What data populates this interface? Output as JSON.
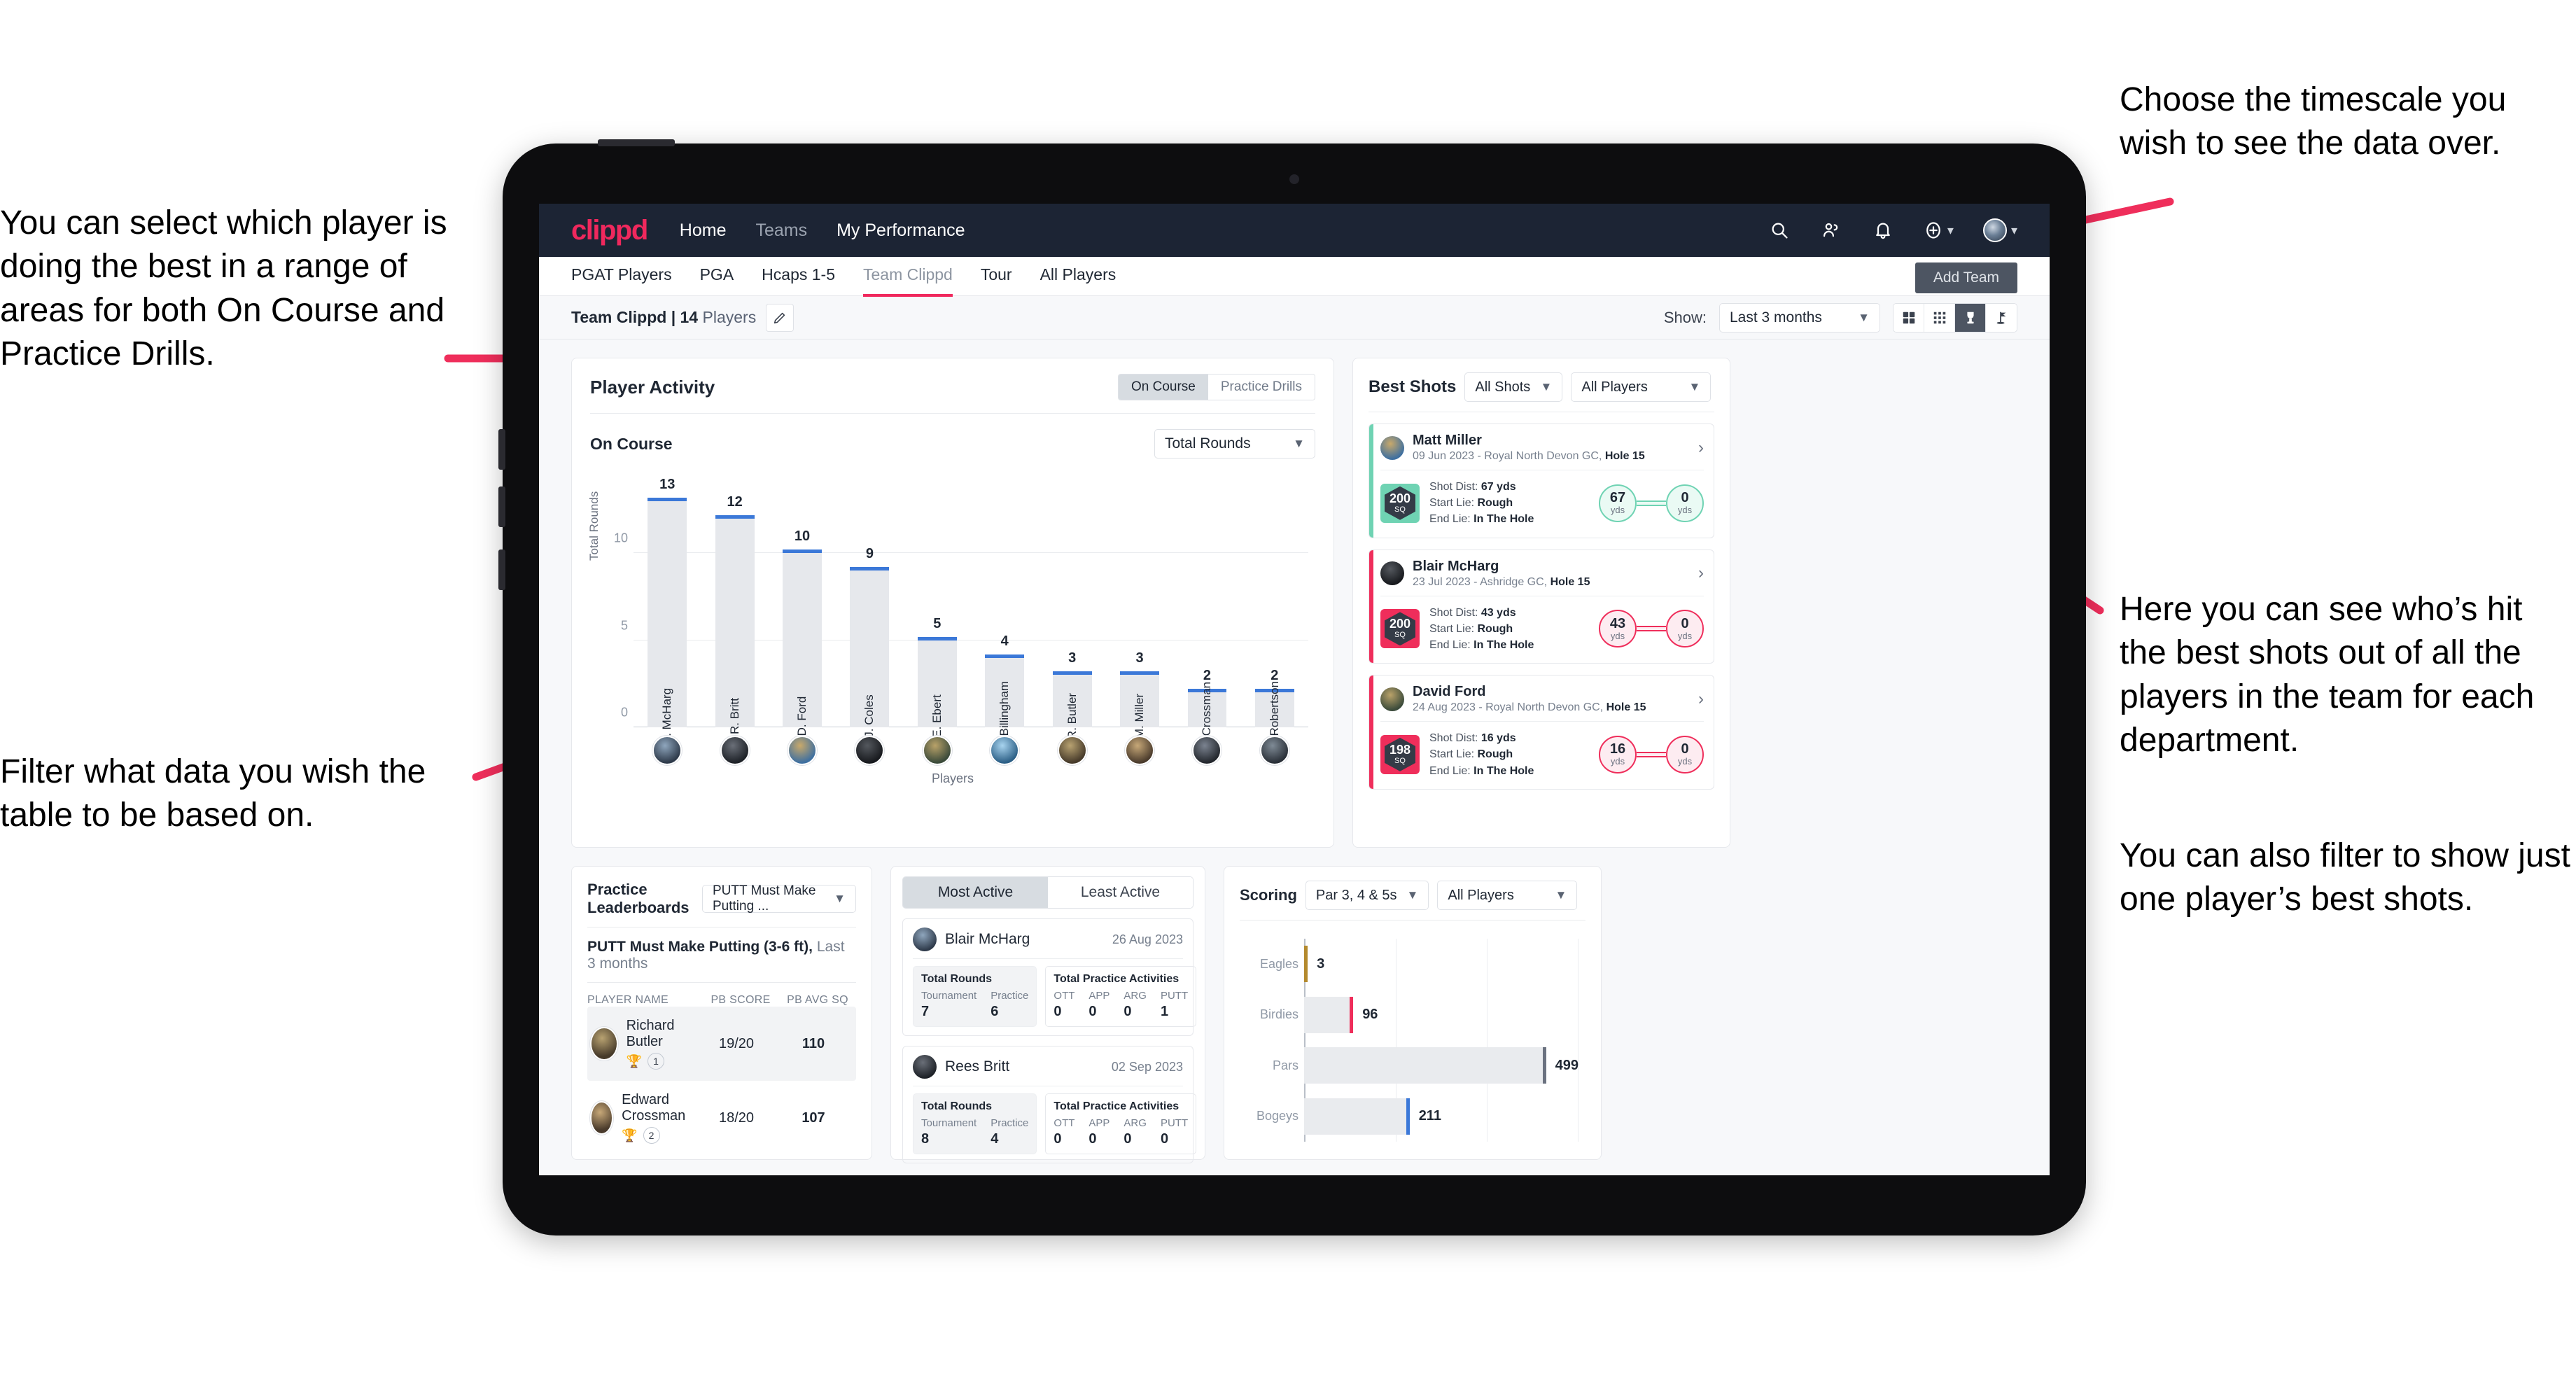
{
  "annotations": {
    "left_top": "You can select which player is doing the best in a range of areas for both On Course and Practice Drills.",
    "left_bottom": "Filter what data you wish the table to be based on.",
    "right_top": "Choose the timescale you wish to see the data over.",
    "right_mid": "Here you can see who’s hit the best shots out of all the players in the team for each department.",
    "right_bottom": "You can also filter to show just one player’s best shots."
  },
  "topnav": {
    "logo": "clippd",
    "links": [
      {
        "label": "Home",
        "dim": false
      },
      {
        "label": "Teams",
        "dim": true
      },
      {
        "label": "My Performance",
        "dim": false
      }
    ],
    "icons": [
      {
        "name": "search-icon"
      },
      {
        "name": "people-icon"
      },
      {
        "name": "bell-icon"
      },
      {
        "name": "plus-circle-icon"
      },
      {
        "name": "avatar"
      }
    ]
  },
  "subnav": {
    "tabs": [
      {
        "label": "PGAT Players",
        "active": false,
        "dim": false
      },
      {
        "label": "PGA",
        "active": false,
        "dim": false
      },
      {
        "label": "Hcaps 1-5",
        "active": false,
        "dim": false
      },
      {
        "label": "Team Clippd",
        "active": true,
        "dim": true
      },
      {
        "label": "Tour",
        "active": false,
        "dim": false
      },
      {
        "label": "All Players",
        "active": false,
        "dim": false
      }
    ],
    "add_team_label": "Add Team"
  },
  "toolbar": {
    "team_name": "Team Clippd | 14",
    "players_word": " Players",
    "edit_icon": "pencil-icon",
    "show_label": "Show:",
    "timescale_value": "Last 3 months",
    "view_buttons": [
      {
        "name": "grid-large-view",
        "active": false
      },
      {
        "name": "grid-small-view",
        "active": false
      },
      {
        "name": "trophy-view",
        "active": true
      },
      {
        "name": "flag-view",
        "active": false
      }
    ]
  },
  "player_activity": {
    "title": "Player Activity",
    "segments": [
      {
        "label": "On Course",
        "active": true
      },
      {
        "label": "Practice Drills",
        "active": false
      }
    ],
    "sub_label": "On Course",
    "metric_value": "Total Rounds"
  },
  "chart_data": {
    "type": "bar",
    "title": "Player Activity – On Course",
    "xlabel": "Players",
    "ylabel": "Total Rounds",
    "ylim": [
      0,
      14
    ],
    "yticks": [
      0,
      5,
      10
    ],
    "grid": true,
    "categories": [
      "B. McHarg",
      "R. Britt",
      "D. Ford",
      "J. Coles",
      "E. Ebert",
      "D. Billingham",
      "R. Butler",
      "M. Miller",
      "E. Crossman",
      "C. Robertson"
    ],
    "values": [
      13,
      12,
      10,
      9,
      5,
      4,
      3,
      3,
      2,
      2
    ],
    "bar_color": "#e6e8ec",
    "cap_color": "#3b78d8"
  },
  "best_shots": {
    "title": "Best Shots",
    "filter_shots": "All Shots",
    "filter_players": "All Players",
    "cards": [
      {
        "player": "Matt Miller",
        "meta_date": "09 Jun 2023 - Royal North Devon GC, ",
        "meta_hole": "Hole 15",
        "sq_value": "200",
        "sq_unit": "SQ",
        "accent": "#6fd3b3",
        "shot_dist_label": "Shot Dist: ",
        "shot_dist": "67 yds",
        "start_lie_label": "Start Lie: ",
        "start_lie": "Rough",
        "end_lie_label": "End Lie: ",
        "end_lie": "In The Hole",
        "from_value": "67",
        "from_unit": "yds",
        "to_value": "0",
        "to_unit": "yds"
      },
      {
        "player": "Blair McHarg",
        "meta_date": "23 Jul 2023 - Ashridge GC, ",
        "meta_hole": "Hole 15",
        "sq_value": "200",
        "sq_unit": "SQ",
        "accent": "#ef2e5b",
        "shot_dist_label": "Shot Dist: ",
        "shot_dist": "43 yds",
        "start_lie_label": "Start Lie: ",
        "start_lie": "Rough",
        "end_lie_label": "End Lie: ",
        "end_lie": "In The Hole",
        "from_value": "43",
        "from_unit": "yds",
        "to_value": "0",
        "to_unit": "yds"
      },
      {
        "player": "David Ford",
        "meta_date": "24 Aug 2023 - Royal North Devon GC, ",
        "meta_hole": "Hole 15",
        "sq_value": "198",
        "sq_unit": "SQ",
        "accent": "#ef2e5b",
        "shot_dist_label": "Shot Dist: ",
        "shot_dist": "16 yds",
        "start_lie_label": "Start Lie: ",
        "start_lie": "Rough",
        "end_lie_label": "End Lie: ",
        "end_lie": "In The Hole",
        "from_value": "16",
        "from_unit": "yds",
        "to_value": "0",
        "to_unit": "yds"
      }
    ]
  },
  "practice_leaderboards": {
    "title": "Practice Leaderboards",
    "drill_select": "PUTT Must Make Putting ...",
    "subtitle_bold": "PUTT Must Make Putting (3-6 ft),",
    "subtitle_light": " Last 3 months",
    "columns": [
      "PLAYER NAME",
      "PB SCORE",
      "PB AVG SQ"
    ],
    "rows": [
      {
        "name": "Richard Butler",
        "rank": "1",
        "trophy": "gold",
        "pb_score": "19/20",
        "pb_avg_sq": "110",
        "highlight": true
      },
      {
        "name": "Edward Crossman",
        "rank": "2",
        "trophy": "silver",
        "pb_score": "18/20",
        "pb_avg_sq": "107",
        "highlight": false
      }
    ]
  },
  "activity_panel": {
    "tabs": [
      {
        "label": "Most Active",
        "active": true
      },
      {
        "label": "Least Active",
        "active": false
      }
    ],
    "cards": [
      {
        "player": "Blair McHarg",
        "date": "26 Aug 2023",
        "rounds_title": "Total Rounds",
        "rounds_cols": [
          "Tournament",
          "Practice"
        ],
        "rounds_vals": [
          "7",
          "6"
        ],
        "practice_title": "Total Practice Activities",
        "practice_cols": [
          "OTT",
          "APP",
          "ARG",
          "PUTT"
        ],
        "practice_vals": [
          "0",
          "0",
          "0",
          "1"
        ]
      },
      {
        "player": "Rees Britt",
        "date": "02 Sep 2023",
        "rounds_title": "Total Rounds",
        "rounds_cols": [
          "Tournament",
          "Practice"
        ],
        "rounds_vals": [
          "8",
          "4"
        ],
        "practice_title": "Total Practice Activities",
        "practice_cols": [
          "OTT",
          "APP",
          "ARG",
          "PUTT"
        ],
        "practice_vals": [
          "0",
          "0",
          "0",
          "0"
        ]
      }
    ]
  },
  "scoring": {
    "title": "Scoring",
    "filter_par": "Par 3, 4 & 5s",
    "filter_players": "All Players",
    "chart": {
      "type": "bar",
      "orientation": "horizontal",
      "categories": [
        "Eagles",
        "Birdies",
        "Pars",
        "Bogeys"
      ],
      "values": [
        3,
        96,
        499,
        211
      ],
      "colors": [
        "#b48a2e",
        "#ef2e5b",
        "#6b7280",
        "#3b78d8"
      ],
      "xlim": [
        0,
        560
      ],
      "grid": true
    }
  },
  "colors": {
    "brand_pink": "#f0285d",
    "nav_dark": "#1c2434",
    "bar_grey": "#e6e8ec",
    "bar_cap_blue": "#3b78d8",
    "teal": "#6fd3b3"
  }
}
